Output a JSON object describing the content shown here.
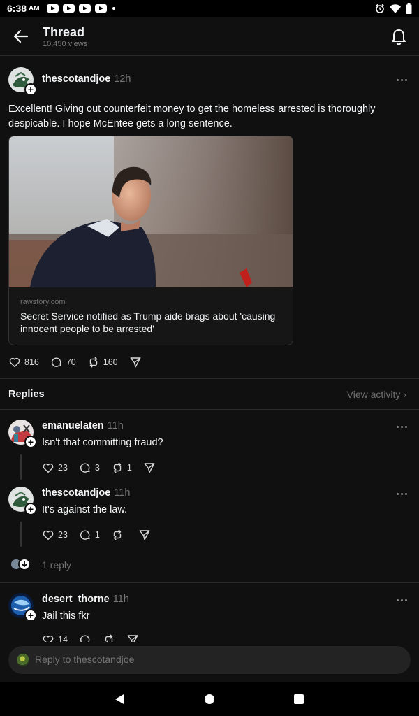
{
  "status_bar": {
    "time": "6:38",
    "ampm": "AM"
  },
  "header": {
    "title": "Thread",
    "views": "10,450 views"
  },
  "post": {
    "username": "thescotandjoe",
    "time": "12h",
    "text": "Excellent!  Giving out counterfeit money to get the homeless arrested is thoroughly despicable.  I hope McEntee gets a long sentence.",
    "link": {
      "domain": "rawstory.com",
      "title": "Secret Service notified as Trump aide brags about 'causing innocent people to be arrested'"
    },
    "likes": "816",
    "comments": "70",
    "reposts": "160"
  },
  "replies_section": {
    "label": "Replies",
    "view_activity": "View activity"
  },
  "replies": [
    {
      "username": "emanuelaten",
      "time": "11h",
      "text": "Isn't that committing fraud?",
      "likes": "23",
      "comments": "3",
      "reposts": "1"
    },
    {
      "username": "thescotandjoe",
      "time": "11h",
      "text": "It's against the law.",
      "likes": "23",
      "comments": "1",
      "reposts": ""
    },
    {
      "username": "desert_thorne",
      "time": "11h",
      "text": "Jail this fkr",
      "likes": "14"
    }
  ],
  "more_replies": {
    "label": "1 reply"
  },
  "compose": {
    "placeholder": "Reply to thescotandjoe"
  },
  "colors": {
    "background": "#101010",
    "text": "#f3f5f7",
    "muted": "#777777",
    "divider": "#2a2a2a"
  }
}
